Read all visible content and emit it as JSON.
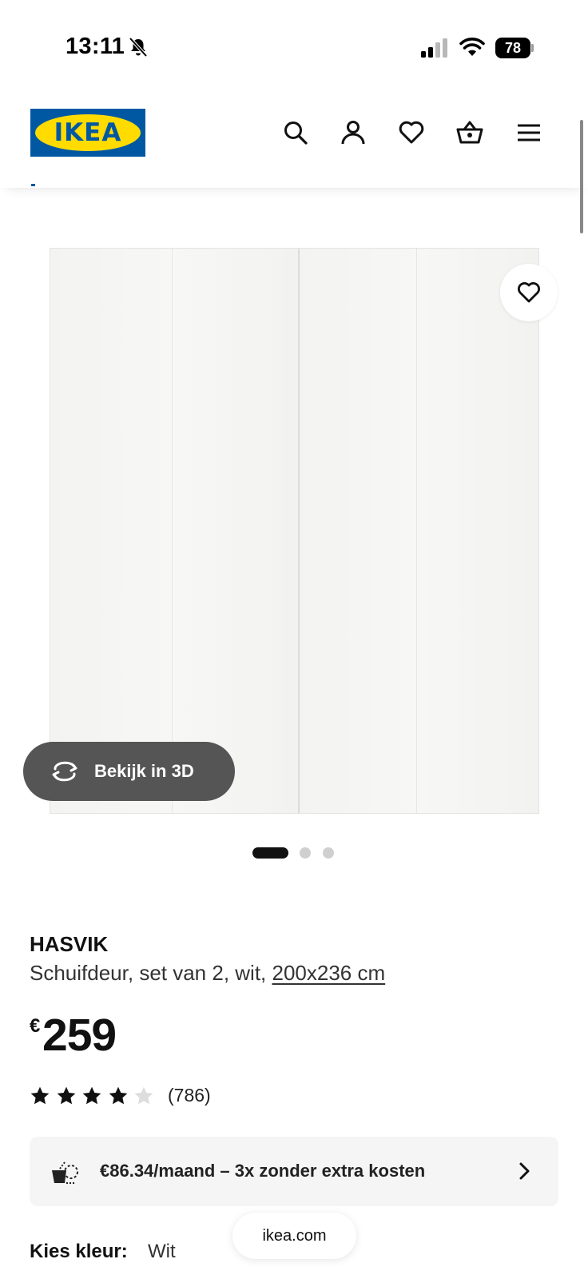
{
  "status_bar": {
    "time": "13:11",
    "battery": "78",
    "icons": [
      "bell-slash-icon",
      "signal-icon",
      "wifi-icon",
      "battery-icon"
    ]
  },
  "header": {
    "logo_text": "IKEA",
    "icons": [
      "search-icon",
      "account-icon",
      "heart-icon",
      "basket-icon",
      "menu-icon"
    ],
    "colors": {
      "logo_blue": "#0058a3",
      "logo_yellow": "#ffdb00"
    }
  },
  "gallery": {
    "view_3d_label": "Bekijk in 3D",
    "active_slide": 1,
    "slide_count": 3
  },
  "product": {
    "name": "HASVIK",
    "description": "Schuifdeur, set van 2, wit, ",
    "dimensions": "200x236 cm",
    "currency": "€",
    "price": "259",
    "rating": 4,
    "rating_max": 5,
    "review_count": "(786)"
  },
  "payment": {
    "text": "€86.34/maand – 3x zonder extra kosten"
  },
  "color_select": {
    "label": "Kies kleur:",
    "value": "Wit"
  },
  "browser": {
    "url": "ikea.com"
  }
}
